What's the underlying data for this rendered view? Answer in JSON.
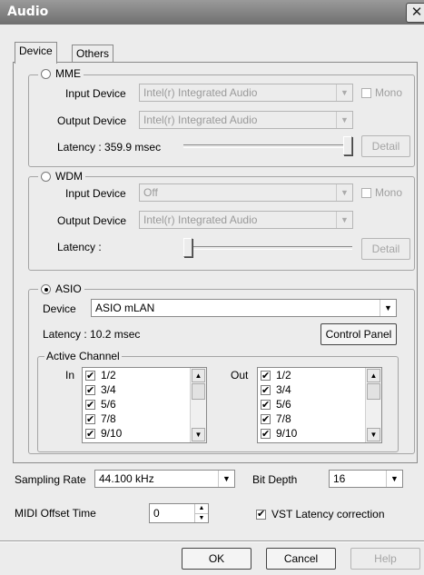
{
  "window": {
    "title": "Audio",
    "close_glyph": "✕"
  },
  "tabs": [
    {
      "label": "Device"
    },
    {
      "label": "Others"
    }
  ],
  "mme": {
    "label": "MME",
    "input_label": "Input Device",
    "input_value": "Intel(r) Integrated Audio",
    "mono_label": "Mono",
    "output_label": "Output Device",
    "output_value": "Intel(r) Integrated Audio",
    "latency_text": "Latency : 359.9 msec",
    "latency_level": 1.0,
    "detail_label": "Detail"
  },
  "wdm": {
    "label": "WDM",
    "input_label": "Input Device",
    "input_value": "Off",
    "mono_label": "Mono",
    "output_label": "Output Device",
    "output_value": "Intel(r) Integrated Audio",
    "latency_text": "Latency :",
    "latency_level": 0.0,
    "detail_label": "Detail"
  },
  "asio": {
    "label": "ASIO",
    "selected": true,
    "device_label": "Device",
    "device_value": "ASIO mLAN",
    "latency_text": "Latency :  10.2 msec",
    "control_panel_label": "Control Panel",
    "active_channel_label": "Active Channel",
    "in_label": "In",
    "out_label": "Out",
    "in_channels": [
      {
        "label": "1/2",
        "checked": true
      },
      {
        "label": "3/4",
        "checked": true
      },
      {
        "label": "5/6",
        "checked": true
      },
      {
        "label": "7/8",
        "checked": true
      },
      {
        "label": "9/10",
        "checked": true
      }
    ],
    "out_channels": [
      {
        "label": "1/2",
        "checked": true
      },
      {
        "label": "3/4",
        "checked": true
      },
      {
        "label": "5/6",
        "checked": true
      },
      {
        "label": "7/8",
        "checked": true
      },
      {
        "label": "9/10",
        "checked": true
      }
    ]
  },
  "sampling": {
    "label": "Sampling Rate",
    "value": "44.100 kHz"
  },
  "bit_depth": {
    "label": "Bit Depth",
    "value": "16"
  },
  "midi_offset": {
    "label": "MIDI Offset Time",
    "value": "0"
  },
  "vst_latency": {
    "label": "VST Latency correction",
    "checked": true
  },
  "buttons": {
    "ok": "OK",
    "cancel": "Cancel",
    "help": "Help"
  },
  "icons": {
    "dropdown": "▼",
    "scroll_up": "▲",
    "scroll_down": "▼"
  }
}
